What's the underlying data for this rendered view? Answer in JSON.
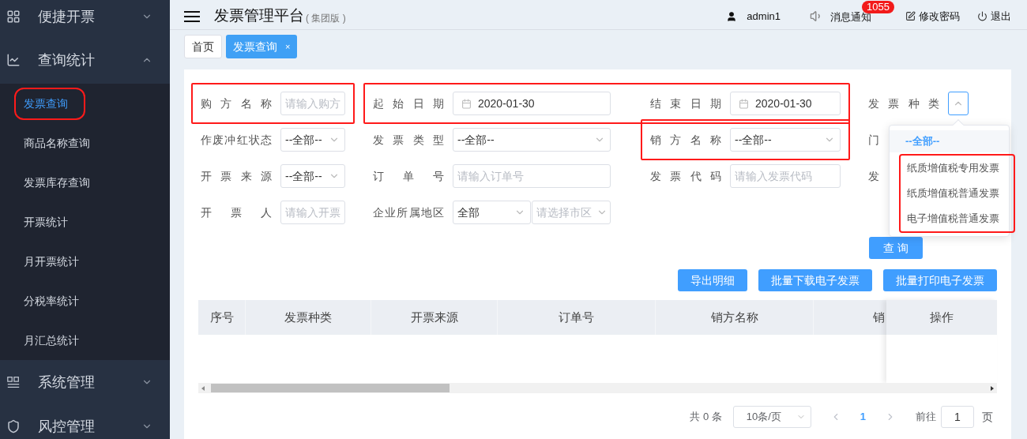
{
  "sidebar": {
    "menus": [
      {
        "label": "便捷开票",
        "expanded": false
      },
      {
        "label": "查询统计",
        "expanded": true,
        "children": [
          {
            "label": "发票查询",
            "selected": true,
            "highlighted": true
          },
          {
            "label": "商品名称查询",
            "selected": false,
            "highlighted": false
          },
          {
            "label": "发票库存查询",
            "selected": false,
            "highlighted": false
          },
          {
            "label": "开票统计",
            "selected": false,
            "highlighted": false
          },
          {
            "label": "月开票统计",
            "selected": false,
            "highlighted": false
          },
          {
            "label": "分税率统计",
            "selected": false,
            "highlighted": false
          },
          {
            "label": "月汇总统计",
            "selected": false,
            "highlighted": false
          }
        ]
      },
      {
        "label": "系统管理",
        "expanded": false
      },
      {
        "label": "风控管理",
        "expanded": false
      }
    ]
  },
  "header": {
    "title": "发票管理平台",
    "subtitle": "( 集团版 )",
    "user": "admin1",
    "notice": "消息通知",
    "badge": "1055",
    "password": "修改密码",
    "logout": "退出"
  },
  "tabs": [
    {
      "label": "首页",
      "selected": false
    },
    {
      "label": "发票查询",
      "selected": true,
      "close": "×"
    }
  ],
  "form": {
    "rows": [
      [
        {
          "highlighted": true,
          "fields": [
            {
              "kind": "text",
              "label": "购 方 名 称",
              "placeholder": "请输入购方"
            }
          ]
        },
        {
          "highlighted": true,
          "fields": [
            {
              "kind": "date",
              "label": "起 始 日 期",
              "value": "2020-01-30"
            },
            {
              "kind": "date",
              "label": "结 束 日 期",
              "value": "2020-01-30"
            }
          ]
        },
        {
          "highlighted": false,
          "fields": [
            {
              "kind": "select",
              "label": "发 票 种 类",
              "expanded": true
            }
          ]
        }
      ],
      [
        {
          "highlighted": false,
          "fields": [
            {
              "kind": "select",
              "label": "作废冲红状态",
              "value": "--全部--",
              "expanded": false
            },
            {
              "kind": "select",
              "label": "发 票 类 型",
              "value": "--全部--",
              "expanded": false
            }
          ]
        },
        {
          "highlighted": true,
          "fields": [
            {
              "kind": "select",
              "label": "销 方 名 称",
              "value": "--全部--",
              "expanded": false
            }
          ]
        },
        {
          "highlighted": false,
          "fields": [
            {
              "kind": "label",
              "label": "门"
            }
          ]
        }
      ],
      [
        {
          "highlighted": false,
          "fields": [
            {
              "kind": "select",
              "label": "开 票 来 源",
              "value": "--全部--",
              "expanded": false
            },
            {
              "kind": "text",
              "label": "订 单 号",
              "placeholder": "请输入订单号"
            },
            {
              "kind": "text",
              "label": "发 票 代 码",
              "placeholder": "请输入发票代码"
            },
            {
              "kind": "label",
              "label": "发"
            }
          ]
        }
      ],
      [
        {
          "highlighted": false,
          "fields": [
            {
              "kind": "text",
              "label": "开 票 人",
              "placeholder": "请输入开票"
            },
            {
              "kind": "region",
              "label": "企业所属地区",
              "value": "全部",
              "placeholder": "请选择市区"
            }
          ]
        }
      ]
    ],
    "query_button": "查 询"
  },
  "dropdown": {
    "options": [
      {
        "label": "--全部--",
        "selected": true,
        "highlighted": false
      },
      {
        "label": "纸质增值税专用发票",
        "selected": false,
        "highlighted": true
      },
      {
        "label": "纸质增值税普通发票",
        "selected": false,
        "highlighted": true
      },
      {
        "label": "电子增值税普通发票",
        "selected": false,
        "highlighted": true
      }
    ]
  },
  "actions": [
    "导出明细",
    "批量下载电子发票",
    "批量打印电子发票"
  ],
  "table": {
    "columns": [
      "序号",
      "发票种类",
      "开票来源",
      "订单号",
      "销方名称",
      "销"
    ],
    "fixed_column": "操作"
  },
  "pagination": {
    "total": "共 0 条",
    "page_size": "10条/页",
    "pages": [
      {
        "label": "1",
        "selected": true
      }
    ],
    "goto": "前往",
    "page_input": "1",
    "page_unit": "页"
  }
}
